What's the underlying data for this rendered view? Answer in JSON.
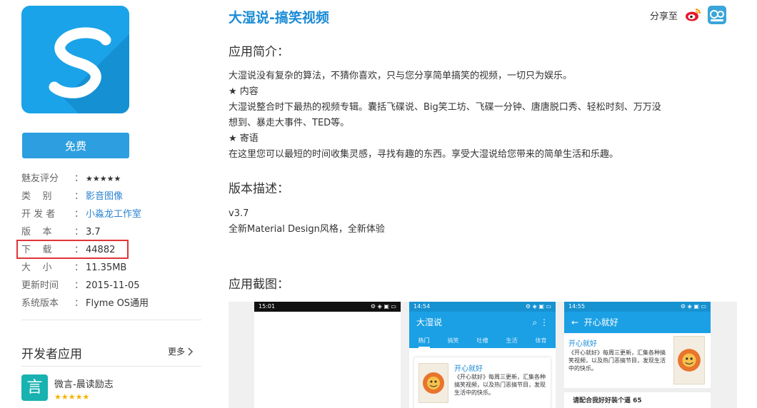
{
  "app": {
    "name": "大湿说-搞笑视频",
    "free_label": "免费",
    "icon_letter": "S"
  },
  "info": [
    {
      "key": "魅友评分",
      "value": "★★★★★",
      "type": "stars"
    },
    {
      "key": "类    别",
      "value": "影音图像",
      "type": "link"
    },
    {
      "key": "开 发 者",
      "value": "小淼龙工作室",
      "type": "link"
    },
    {
      "key": "版    本",
      "value": "3.7",
      "type": "text"
    },
    {
      "key": "下    载",
      "value": "44882",
      "type": "text"
    },
    {
      "key": "大    小",
      "value": "11.35MB",
      "type": "text"
    },
    {
      "key": "更新时间",
      "value": "2015-11-05",
      "type": "text"
    },
    {
      "key": "系统版本",
      "value": "Flyme OS通用",
      "type": "text"
    }
  ],
  "info_sep": "：",
  "developer_apps": {
    "title": "开发者应用",
    "more": "更多",
    "items": [
      {
        "name": "微言-晨读励志",
        "stars": "★★★★★",
        "icon_char": "言"
      }
    ]
  },
  "share": {
    "label": "分享至"
  },
  "sections": {
    "intro_title": "应用简介：",
    "intro_lines": [
      "大湿说没有复杂的算法，不猜你喜欢，只与您分享简单搞笑的视频，一切只为娱乐。",
      "★ 内容",
      "大湿说整合时下最热的视频专辑。囊括飞碟说、Big笑工坊、飞碟一分钟、唐唐脱口秀、轻松时刻、万万没",
      "想到、暴走大事件、TED等。",
      "★ 寄语",
      "在这里您可以最短的时间收集灵感，寻找有趣的东西。享受大湿说给您带来的简单生活和乐趣。"
    ],
    "version_title": "版本描述：",
    "version_lines": [
      "v3.7",
      "全新Material Design风格，全新体验"
    ],
    "screens_title": "应用截图："
  },
  "screenshots": [
    {
      "time": "15:01"
    },
    {
      "time": "14:54",
      "appbar": "大湿说",
      "tabs": [
        "热门",
        "搞笑",
        "吐槽",
        "生活",
        "体育"
      ],
      "card_title": "开心就好",
      "card_text": "《开心就好》每周三更新，汇集各种搞笑视频，以及热门恶搞节目，发现生活中的快乐。"
    },
    {
      "time": "14:55",
      "appbar": "开心就好",
      "card_title": "开心就好",
      "card_text": "《开心就好》每周三更新，汇集各种搞笑视频，以及热门恶搞节目，发现生活中的快乐。",
      "footer": "请配合我好好装个逼 65"
    }
  ],
  "colors": {
    "accent": "#1aa3e8",
    "title": "#1a8bd6",
    "highlight_box": "#e0343a",
    "stars": "#f5b400"
  }
}
